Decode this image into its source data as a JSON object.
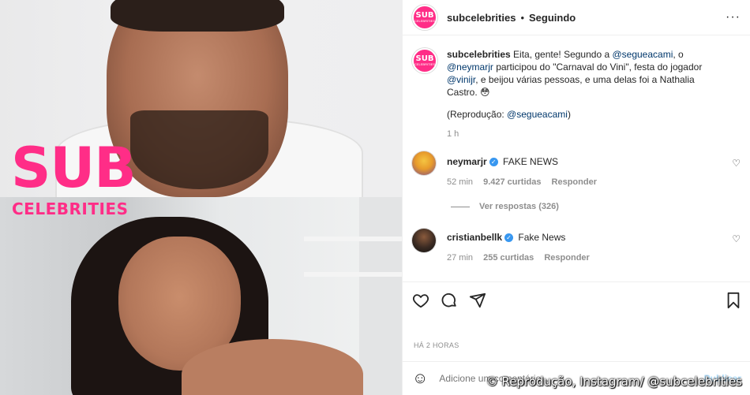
{
  "media": {
    "logo_line1": "SUB",
    "logo_line2": "CELEBRITIES"
  },
  "header": {
    "avatar_text": "SUB",
    "avatar_subtext": "CELEBRITIES",
    "username": "subcelebrities",
    "separator": "•",
    "follow_status": "Seguindo",
    "more": "···"
  },
  "caption": {
    "username": "subcelebrities",
    "part1": " Eita, gente! Segundo a ",
    "mention1": "@segueacami",
    "part2": ", o ",
    "mention2": "@neymarjr",
    "part3": " participou do \"Carnaval do Vini\", festa do jogador ",
    "mention3": "@vinijr",
    "part4": ", e beijou várias pessoas, e uma delas foi a Nathalia Castro. 😳",
    "repro_prefix": "(Reprodução: ",
    "repro_mention": "@segueacami",
    "repro_suffix": ")",
    "time": "1 h"
  },
  "comments": [
    {
      "username": "neymarjr",
      "text": "FAKE NEWS",
      "time": "52 min",
      "likes": "9.427 curtidas",
      "reply": "Responder",
      "view_replies": "Ver respostas (326)"
    },
    {
      "username": "cristianbellk",
      "text": "Fake News",
      "time": "27 min",
      "likes": "255 curtidas",
      "reply": "Responder"
    }
  ],
  "post": {
    "time_ago": "HÁ 2 HORAS"
  },
  "add_comment": {
    "placeholder": "Adicione um comentário...",
    "publish": "Publicar"
  },
  "watermark": "© Reprodução, Instagram/ @subcelebrities",
  "colors": {
    "brand_pink": "#ff2d87",
    "link": "#00376b",
    "verified": "#3897f0",
    "muted": "#8e8e8e"
  }
}
